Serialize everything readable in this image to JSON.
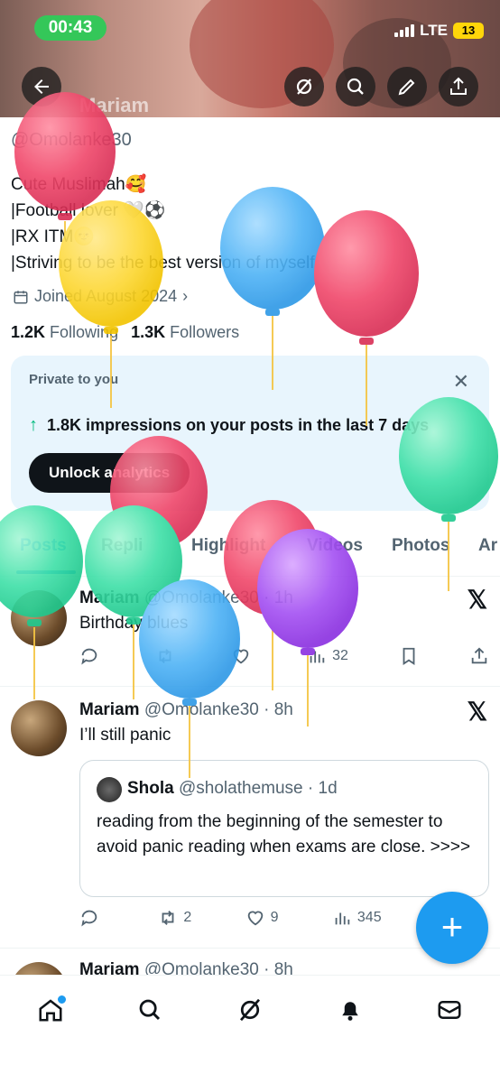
{
  "status_bar": {
    "time": "00:43",
    "network": "LTE",
    "battery": "13"
  },
  "header": {
    "name_overlay": "Mariam"
  },
  "profile": {
    "handle": "@Omolanke30",
    "bio": [
      "Cute Muslimah🥰",
      "|Football lover 🤍⚽",
      "|RX ITM🌝",
      "|Striving to be the best version of myself"
    ],
    "joined": "Joined August 2024",
    "following_count": "1.2K",
    "following_label": "Following",
    "followers_count": "1.3K",
    "followers_label": "Followers"
  },
  "analytics_card": {
    "label": "Private to you",
    "impressions": "1.8K impressions on your posts in the last 7 days",
    "button": "Unlock analytics"
  },
  "tabs": [
    "Posts",
    "Replies",
    "Highlights",
    "Videos",
    "Photos",
    "Articles"
  ],
  "tabs_visible_text": {
    "t0": "Posts",
    "t1": "Repli",
    "t2": "Highlight",
    "t3": "Videos",
    "t4": "Photos",
    "t5": "Ar"
  },
  "tweets": [
    {
      "name": "Mariam",
      "handle": "@Omolanke30",
      "time": "· 1h",
      "text": "Birthday blues",
      "replies": "",
      "reposts": "",
      "likes": "",
      "views": "32"
    },
    {
      "name": "Mariam",
      "handle": "@Omolanke30",
      "time": "· 8h",
      "text": "I’ll still panic",
      "quote": {
        "name": "Shola",
        "handle": "@sholathemuse",
        "time": "· 1d",
        "text": "reading from the beginning of the semester to avoid panic reading when exams are close. >>>>"
      },
      "replies": "",
      "reposts": "2",
      "likes": "9",
      "views": "345"
    },
    {
      "name": "Mariam",
      "handle": "@Omolanke30",
      "time": "· 8h"
    }
  ],
  "colors": {
    "accent": "#1d9bf0",
    "text": "#0f1419",
    "muted": "#536471",
    "card_bg": "#e8f5fd",
    "growth": "#00ba7c"
  },
  "icons": [
    "back-arrow-icon",
    "grok-icon",
    "search-icon",
    "edit-icon",
    "share-icon",
    "calendar-icon",
    "chevron-right-icon",
    "close-icon",
    "arrow-up-icon",
    "x-logo-icon",
    "reply-icon",
    "repost-icon",
    "like-icon",
    "views-icon",
    "bookmark-icon",
    "home-icon",
    "bell-icon",
    "mail-icon",
    "plus-icon",
    "balloon-icon"
  ]
}
